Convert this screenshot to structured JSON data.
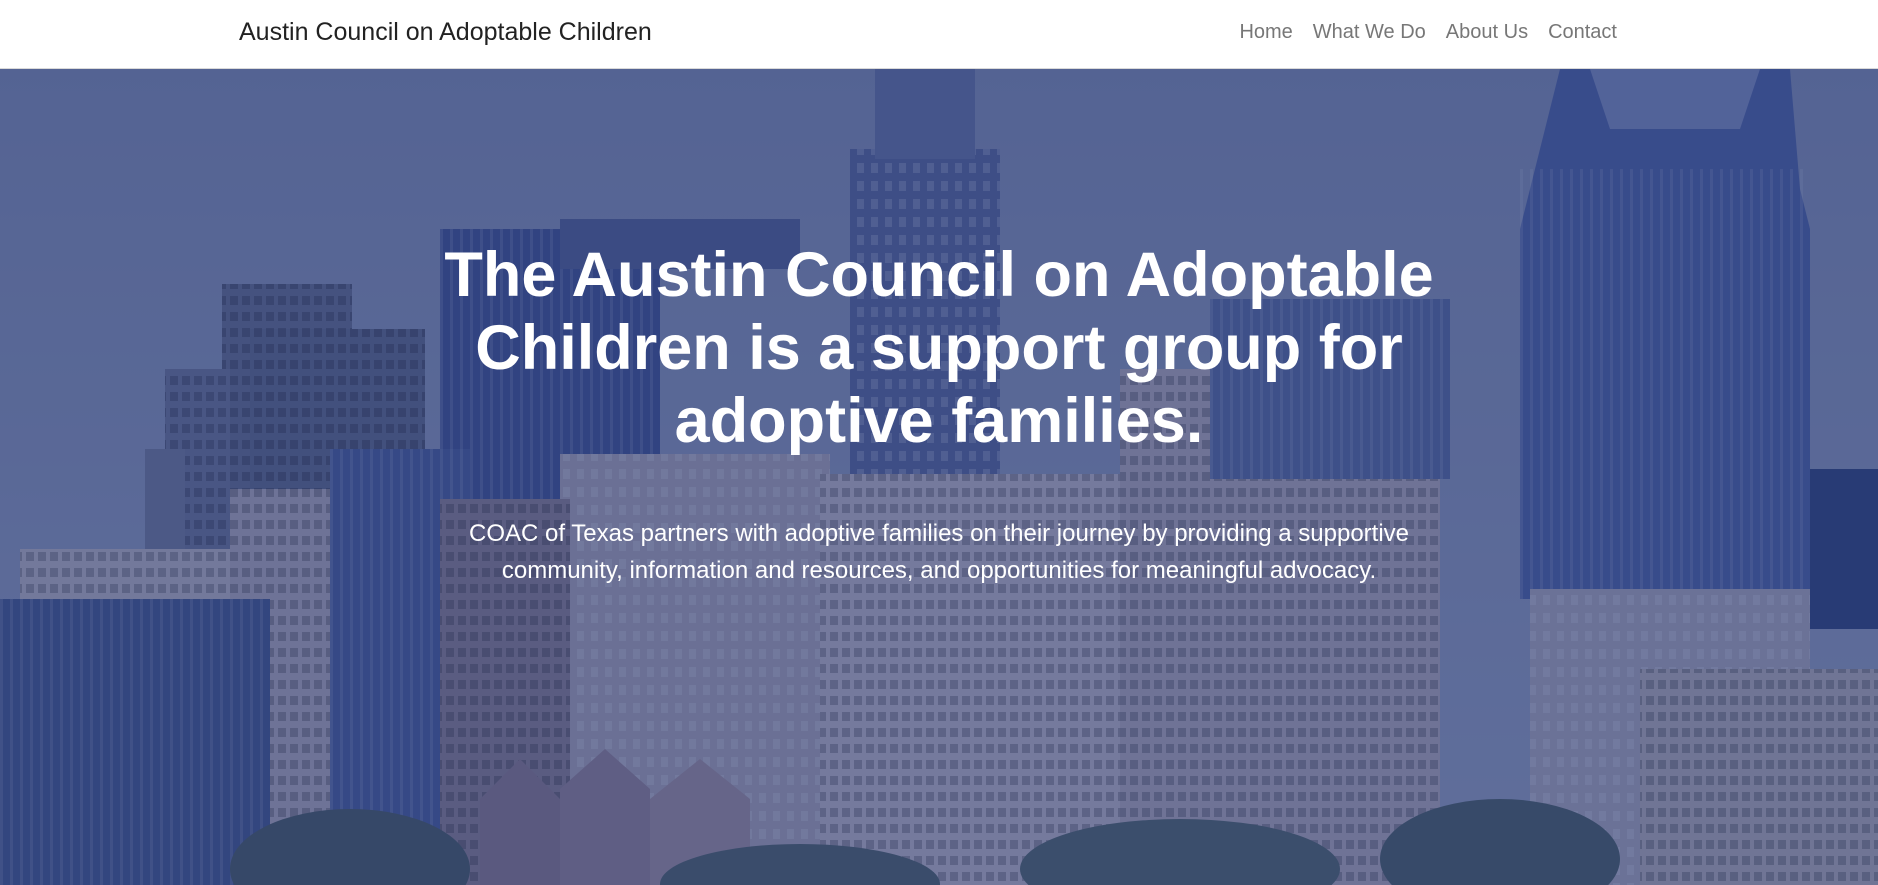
{
  "navbar": {
    "brand": "Austin Council on Adoptable Children",
    "links": [
      "Home",
      "What We Do",
      "About Us",
      "Contact"
    ]
  },
  "hero": {
    "headline": "The Austin Council on Adoptable Children is a support group for adoptive families.",
    "subhead": "COAC of Texas partners with adoptive families on their journey by providing a supportive community, information and resources, and opportunities for meaningful advocacy.",
    "background_image": "austin-skyline-photo",
    "overlay_color": "#263a7a"
  },
  "colors": {
    "navbar_bg": "#ffffff",
    "brand_text": "#222222",
    "nav_link": "#777777",
    "hero_text": "#ffffff"
  }
}
